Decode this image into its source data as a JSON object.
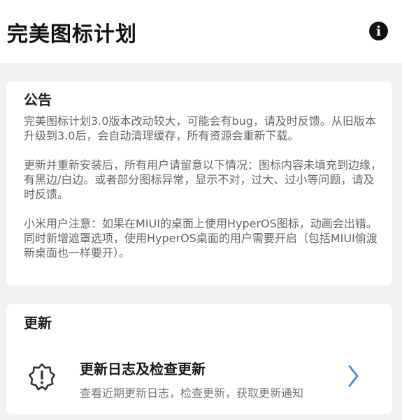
{
  "appbar": {
    "title": "完美图标计划",
    "info_icon": "info-icon",
    "info_glyph": "i"
  },
  "notice": {
    "title": "公告",
    "paragraphs": [
      "完美图标计划3.0版本改动较大，可能会有bug，请及时反馈。从旧版本升级到3.0后，会自动清理缓存，所有资源会重新下载。",
      "更新并重新安装后，所有用户请留意以下情况：图标内容未填充到边缘，有黑边/白边。或者部分图标异常，显示不对，过大、过小等问题，请及时反馈。",
      "小米用户注意：如果在MIUI的桌面上使用HyperOS图标，动画会出错。同时新增遮罩选项，使用HyperOS桌面的用户需要开启（包括MIUI偷渡新桌面也一样要开）。"
    ]
  },
  "update": {
    "title": "更新",
    "item": {
      "icon": "alert-badge-icon",
      "title": "更新日志及检查更新",
      "subtitle": "查看近期更新日志，检查更新，获取更新通知",
      "chevron_icon": "chevron-right-icon"
    }
  },
  "colors": {
    "background": "#f2f2f2",
    "card": "#ffffff",
    "chevron": "#4a90e2"
  }
}
